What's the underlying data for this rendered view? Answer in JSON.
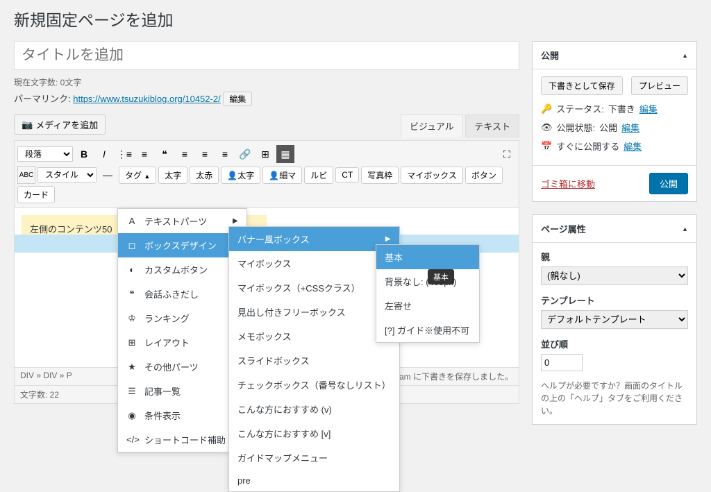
{
  "page_title": "新規固定ページを追加",
  "title_placeholder": "タイトルを追加",
  "charcount": "現在文字数: 0文字",
  "permalink_label": "パーマリンク: ",
  "permalink_url": "https://www.tsuzukiblog.org/10452-2/",
  "edit_label": "編集",
  "media_btn": "メディアを追加",
  "tabs": {
    "visual": "ビジュアル",
    "text": "テキスト"
  },
  "format_sel": "段落",
  "style_sel": "スタイル",
  "tag_btn": "タグ",
  "tagbtns": [
    "太字",
    "太赤",
    "太字",
    "細マ",
    "ルビ",
    "CT",
    "写真枠",
    "マイボックス",
    "ボタン",
    "カード"
  ],
  "content_text": "左側のコンテンツ50",
  "menu1": [
    {
      "ico": "A",
      "label": "テキストパーツ",
      "arr": true
    },
    {
      "ico": "◻",
      "label": "ボックスデザイン",
      "arr": true,
      "hl": true
    },
    {
      "ico": "◐",
      "label": "カスタムボタン",
      "arr": true
    },
    {
      "ico": "❝",
      "label": "会話ふきだし",
      "arr": true
    },
    {
      "ico": "♔",
      "label": "ランキング",
      "arr": true
    },
    {
      "ico": "⊞",
      "label": "レイアウト",
      "arr": true
    },
    {
      "ico": "★",
      "label": "その他パーツ",
      "arr": true
    },
    {
      "ico": "☰",
      "label": "記事一覧",
      "arr": true
    },
    {
      "ico": "◉",
      "label": "条件表示",
      "arr": true
    },
    {
      "ico": "</>",
      "label": "ショートコード補助",
      "arr": true
    }
  ],
  "menu2": [
    {
      "label": "バナー風ボックス",
      "arr": true,
      "hl": true
    },
    {
      "label": "マイボックス",
      "arr": true
    },
    {
      "label": "マイボックス（+CSSクラス）",
      "arr": true
    },
    {
      "label": "見出し付きフリーボックス",
      "arr": true
    },
    {
      "label": "メモボックス"
    },
    {
      "label": "スライドボックス"
    },
    {
      "label": "チェックボックス（番号なしリスト）"
    },
    {
      "label": "こんな方におすすめ (v)"
    },
    {
      "label": "こんな方におすすめ [v]"
    },
    {
      "label": "ガイドマップメニュー"
    },
    {
      "label": "pre"
    }
  ],
  "menu3": [
    {
      "label": "基本",
      "hl": true
    },
    {
      "label": "背景なし: (400px)"
    },
    {
      "label": "左寄せ"
    },
    {
      "label": "[?] ガイド※使用不可"
    }
  ],
  "tooltip": "基本",
  "footer_path": "DIV » DIV » P",
  "footer_wc": "文字数: 22",
  "footer_saved": "3:01:52 am に下書きを保存しました。",
  "publish": {
    "title": "公開",
    "save_draft": "下書きとして保存",
    "preview": "プレビュー",
    "status_label": "ステータス: ",
    "status_val": "下書き",
    "vis_label": "公開状態: ",
    "vis_val": "公開",
    "sched_label": "すぐに公開する",
    "trash": "ゴミ箱に移動",
    "submit": "公開"
  },
  "attrs": {
    "title": "ページ属性",
    "parent_label": "親",
    "parent_val": "(親なし)",
    "template_label": "テンプレート",
    "template_val": "デフォルトテンプレート",
    "order_label": "並び順",
    "order_val": "0",
    "help": "ヘルプが必要ですか？画面のタイトルの上の「ヘルプ」タブをご利用ください。"
  }
}
